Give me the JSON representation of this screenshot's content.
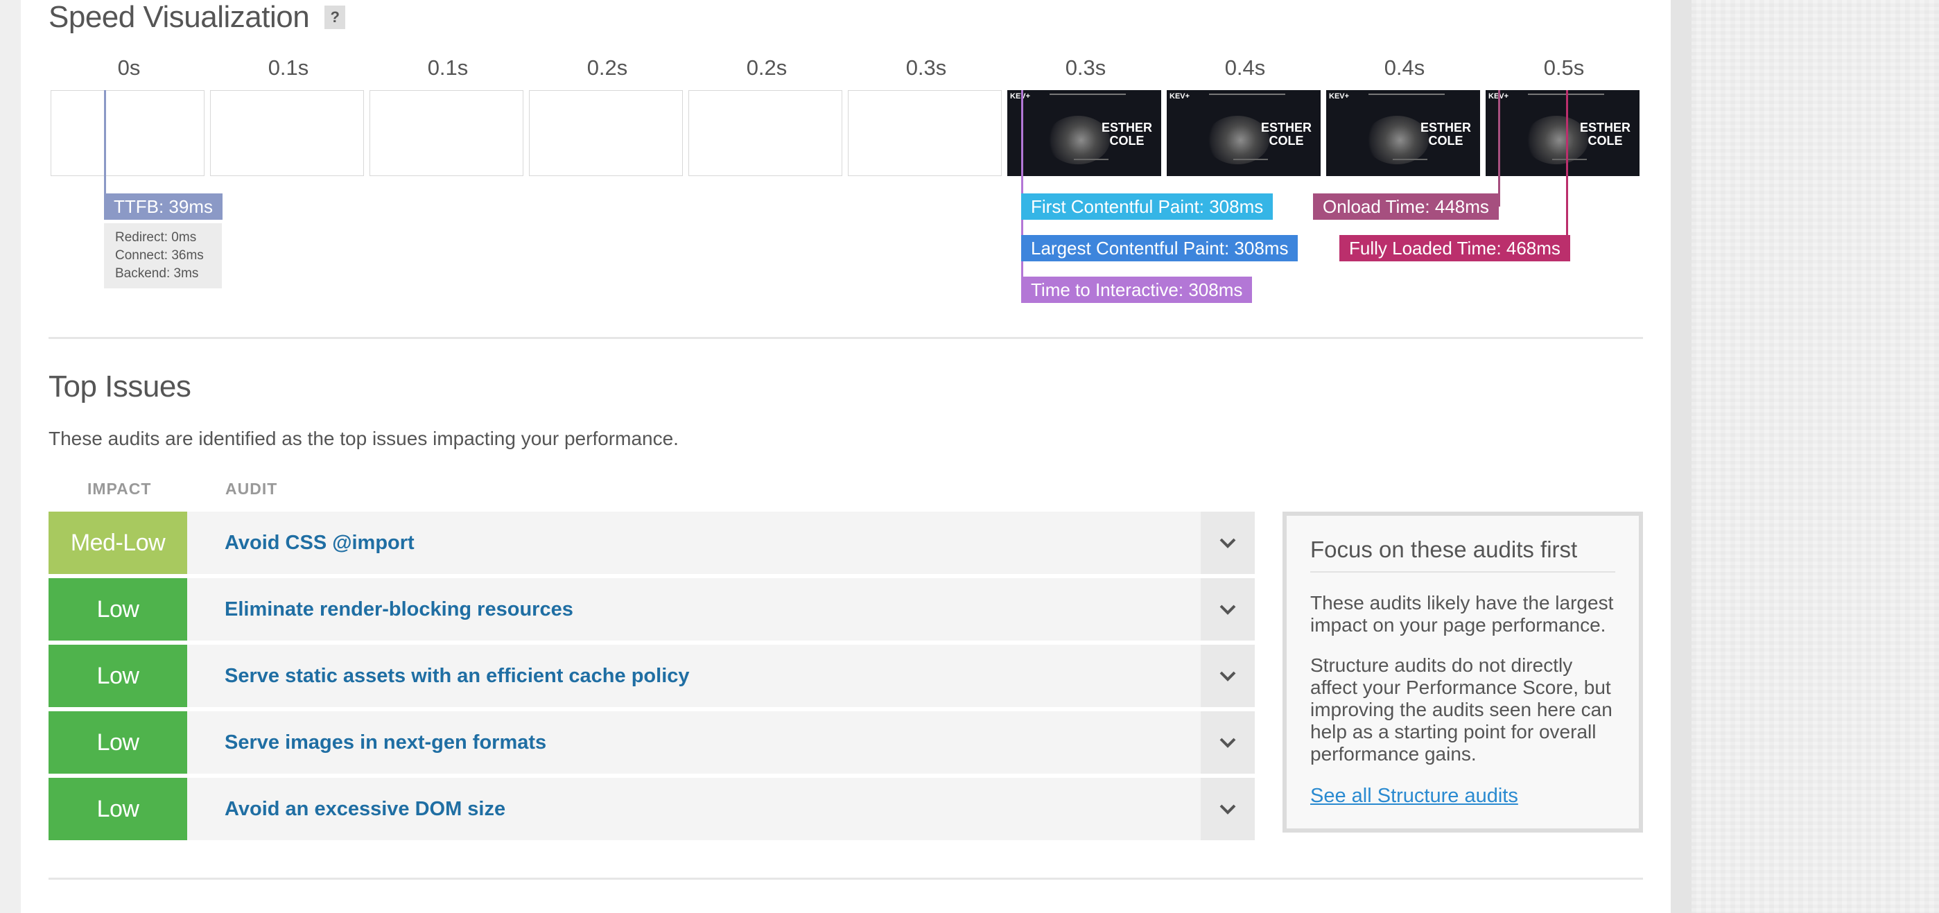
{
  "speed_visualization": {
    "title": "Speed Visualization",
    "help_label": "?",
    "timeline_labels": [
      "0s",
      "0.1s",
      "0.1s",
      "0.2s",
      "0.2s",
      "0.3s",
      "0.3s",
      "0.4s",
      "0.4s",
      "0.5s"
    ],
    "screenshot": {
      "logo_text": "KEV+",
      "name_line1": "ESTHER",
      "name_line2": "COLE"
    },
    "markers": {
      "ttfb": "TTFB: 39ms",
      "ttfb_details": {
        "redirect": "Redirect: 0ms",
        "connect": "Connect: 36ms",
        "backend": "Backend: 3ms"
      },
      "fcp": "First Contentful Paint: 308ms",
      "lcp": "Largest Contentful Paint: 308ms",
      "tti": "Time to Interactive: 308ms",
      "onload": "Onload Time: 448ms",
      "fully_loaded": "Fully Loaded Time: 468ms"
    },
    "colors": {
      "ttfb": "#8b99c6",
      "fcp": "#35b5e6",
      "lcp": "#3d85dc",
      "tti": "#b377d6",
      "onload": "#a64f7f",
      "fully_loaded": "#bb2f6c"
    }
  },
  "top_issues": {
    "title": "Top Issues",
    "description": "These audits are identified as the top issues impacting your performance.",
    "headers": {
      "impact": "IMPACT",
      "audit": "AUDIT"
    },
    "rows": [
      {
        "impact": "Med-Low",
        "audit": "Avoid CSS @import",
        "color": "#a8c95f"
      },
      {
        "impact": "Low",
        "audit": "Eliminate render-blocking resources",
        "color": "#4fb34c"
      },
      {
        "impact": "Low",
        "audit": "Serve static assets with an efficient cache policy",
        "color": "#4fb34c"
      },
      {
        "impact": "Low",
        "audit": "Serve images in next-gen formats",
        "color": "#4fb34c"
      },
      {
        "impact": "Low",
        "audit": "Avoid an excessive DOM size",
        "color": "#4fb34c"
      }
    ],
    "focus_box": {
      "title": "Focus on these audits first",
      "p1": "These audits likely have the largest impact on your page performance.",
      "p2": "Structure audits do not directly affect your Performance Score, but improving the audits seen here can help as a starting point for overall performance gains.",
      "link": "See all Structure audits"
    }
  }
}
